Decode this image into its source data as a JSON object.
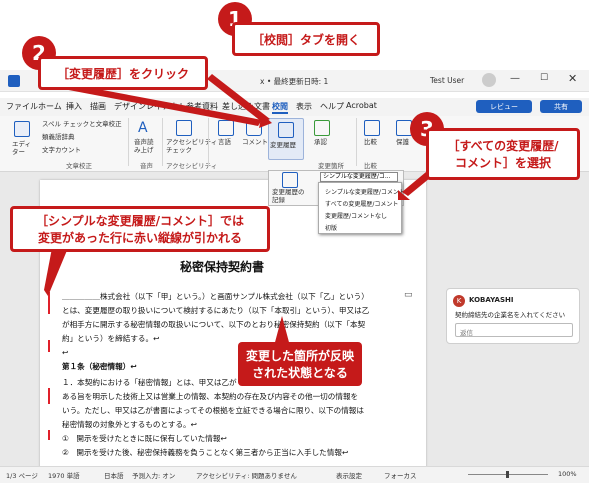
{
  "window": {
    "title": "x • 最終更新日時: 1",
    "title_suffix": "日",
    "user": "Test User"
  },
  "menu": [
    "ファイル",
    "ホーム",
    "挿入",
    "描画",
    "デザイン",
    "レイアウト",
    "参考資料",
    "差し込み文書",
    "校閲",
    "表示",
    "ヘルプ",
    "Acrobat"
  ],
  "menu_active": "校閲",
  "review_button": "レビュー",
  "share_button": "共有",
  "ribbon": {
    "proofing": {
      "items": [
        "スペル チェックと文章校正",
        "類義語辞典",
        "文字カウント"
      ],
      "editor": "エディ\nター",
      "label": "文章校正"
    },
    "speech": {
      "button": "音声読\nみ上げ",
      "label": "音声"
    },
    "accessibility": {
      "button": "アクセシビリティ\nチェック",
      "label": "アクセシビリティ"
    },
    "language": {
      "button": "言語",
      "label": ""
    },
    "comment": {
      "button": "コメント",
      "label": ""
    },
    "tracking": {
      "button": "変更履歴",
      "label": ""
    },
    "changes": {
      "accept": "承認",
      "label": "変更箇所"
    },
    "compare": {
      "button": "比較",
      "label": "比較"
    },
    "protect": {
      "button": "保護"
    }
  },
  "markup": {
    "select_value": "シンプルな変更履歴/コ...",
    "panel_button": "変更履歴の\n記録",
    "options": [
      "シンプルな変更履歴/コメント",
      "すべての変更履歴/コメント",
      "変更履歴/コメントなし",
      "初版"
    ]
  },
  "document": {
    "heading": "秘密保持契約書",
    "lines": [
      "＿＿＿＿＿株式会社（以下「甲」という。）と画面サンプル株式会社（以下「乙」という）",
      "とは、変更履歴の取り扱いについて検討するにあたり（以下「本取引」という）、甲又は乙",
      "が相手方に開示する秘密情報の取扱いについて、以下のとおり秘密保持契約（以下「本契",
      "約」という）を締結する。↩",
      "↩",
      "第１条（秘密情報）↩",
      "１．本契約における「秘密情報」とは、甲又は乙が",
      "ある旨を明示した技術上又は営業上の情報、本契約の存在及び内容その他一切の情報を",
      "いう。ただし、甲又は乙が書面によってその根拠を立証できる場合に限り、以下の情報は",
      "秘密情報の対象外とするものとする。↩",
      "①　開示を受けたときに既に保有していた情報↩",
      "②　開示を受けた後、秘密保持義務を負うことなく第三者から正当に入手した情報↩"
    ]
  },
  "comment": {
    "author": "KOBAYASHI",
    "initial": "K",
    "text": "契約締結先の企業名を入れてください",
    "reply_placeholder": "返信"
  },
  "status": {
    "page": "1/3 ページ",
    "words": "1970 単語",
    "language": "日本語",
    "predict": "予測入力: オン",
    "accessibility": "アクセシビリティ: 問題ありません",
    "display": "表示設定",
    "focus": "フォーカス",
    "zoom": "100%"
  },
  "callouts": {
    "c1_num": "1",
    "c1_text": "［校閲］タブを開く",
    "c2_num": "2",
    "c2_text": "［変更履歴］をクリック",
    "c3_num": "3",
    "c3_line1": "［すべての変更履歴/",
    "c3_line2": "コメント］を選択",
    "c4_line1": "［シンプルな変更履歴/コメント］では",
    "c4_line2": "変更があった行に赤い縦線が引かれる",
    "c5_line1": "変更した箇所が反映",
    "c5_line2": "された状態となる"
  },
  "colors": {
    "accent": "#c51a1a",
    "word_blue": "#1f5fbf"
  }
}
